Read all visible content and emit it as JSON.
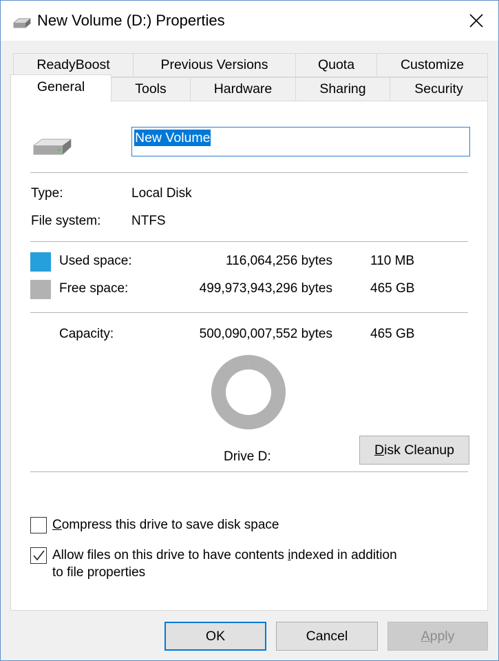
{
  "window": {
    "title": "New Volume (D:) Properties"
  },
  "tabs": {
    "row1": [
      "ReadyBoost",
      "Previous Versions",
      "Quota",
      "Customize"
    ],
    "row2": [
      "General",
      "Tools",
      "Hardware",
      "Sharing",
      "Security"
    ],
    "active": "General"
  },
  "general": {
    "volume_name": "New Volume",
    "type_label": "Type:",
    "type_value": "Local Disk",
    "fs_label": "File system:",
    "fs_value": "NTFS",
    "used_label": "Used space:",
    "used_bytes": "116,064,256 bytes",
    "used_size": "110 MB",
    "free_label": "Free space:",
    "free_bytes": "499,973,943,296 bytes",
    "free_size": "465 GB",
    "capacity_label": "Capacity:",
    "capacity_bytes": "500,090,007,552 bytes",
    "capacity_size": "465 GB",
    "drive_label": "Drive D:",
    "disk_cleanup_mnemonic": "D",
    "disk_cleanup_rest": "isk Cleanup",
    "compress_mnemonic": "C",
    "compress_rest": "ompress this drive to save disk space",
    "compress_checked": false,
    "index_text_before": "Allow files on this drive to have contents ",
    "index_mnemonic": "i",
    "index_text_after": "ndexed in addition",
    "index_line2": "to file properties",
    "index_checked": true
  },
  "footer": {
    "ok_label": "OK",
    "cancel_label": "Cancel",
    "apply_mnemonic": "A",
    "apply_rest": "pply"
  },
  "colors": {
    "used": "#26a0da",
    "free": "#b2b2b2",
    "accent": "#0078d7"
  },
  "chart_data": {
    "type": "pie",
    "categories": [
      "Used space",
      "Free space"
    ],
    "values": [
      116064256,
      499973943296
    ]
  }
}
